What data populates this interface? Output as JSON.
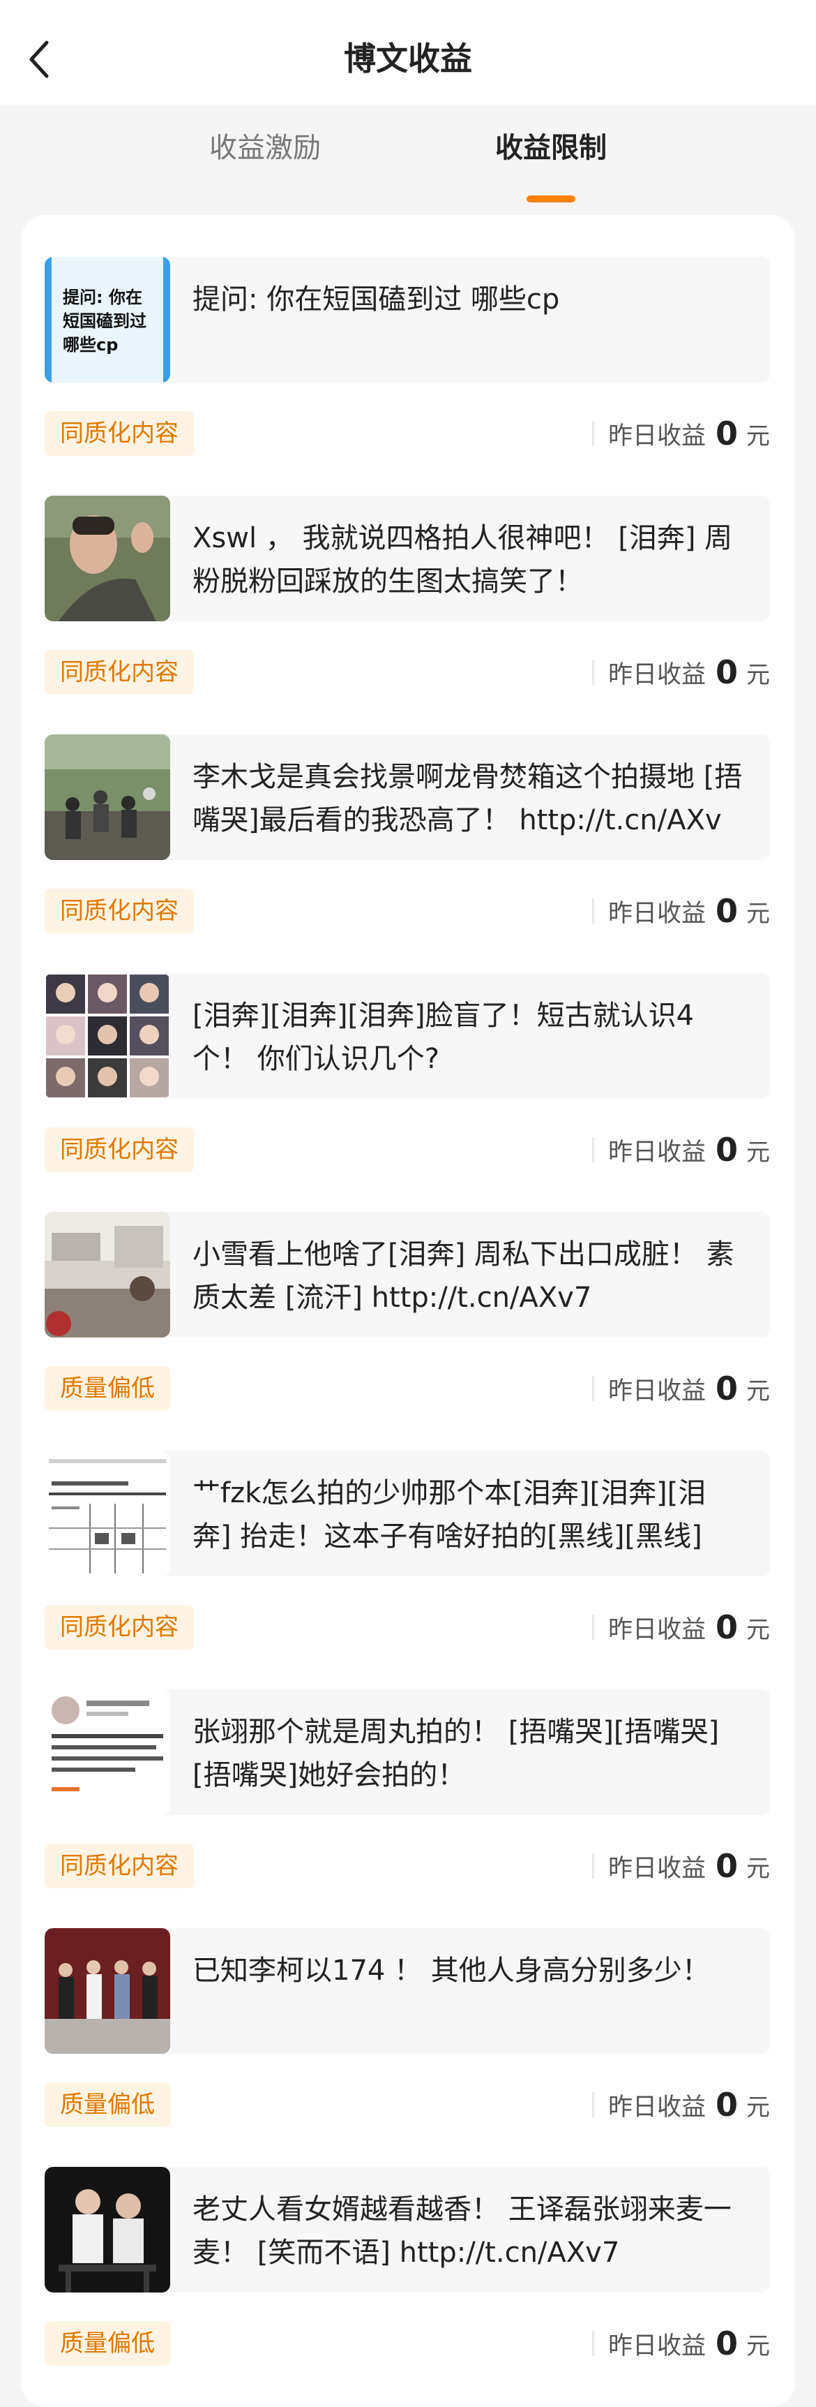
{
  "header": {
    "title": "博文收益"
  },
  "tabs": [
    {
      "label": "收益激励",
      "active": false
    },
    {
      "label": "收益限制",
      "active": true
    }
  ],
  "colors": {
    "accent": "#ff8200",
    "tag_bg": "#fff4e3",
    "tag_text": "#e07800"
  },
  "earnings_label": "昨日收益",
  "currency_unit": "元",
  "posts": [
    {
      "thumb": "thumb-text-card",
      "thumb_text": "提问: 你在短国磕到过哪些cp",
      "text": "提问: 你在短国磕到过 哪些cp",
      "tag": "同质化内容",
      "earnings": "0"
    },
    {
      "thumb": "thumb-man-photo",
      "text": "Xswl ， 我就说四格拍人很神吧！ [泪奔] 周粉脱粉回踩放的生图太搞笑了！",
      "tag": "同质化内容",
      "earnings": "0"
    },
    {
      "thumb": "thumb-crowd-photo",
      "text": "李木戈是真会找景啊龙骨焚箱这个拍摄地 [捂嘴哭]最后看的我恐高了！ http://t.cn/AXv",
      "tag": "同质化内容",
      "earnings": "0"
    },
    {
      "thumb": "thumb-portrait-grid",
      "text": "[泪奔][泪奔][泪奔]脸盲了！短古就认识4个！ 你们认识几个?",
      "tag": "同质化内容",
      "earnings": "0"
    },
    {
      "thumb": "thumb-train-photo",
      "text": "小雪看上他啥了[泪奔] 周私下出口成脏！ 素质太差 [流汗] http://t.cn/AXv7",
      "tag": "质量偏低",
      "earnings": "0"
    },
    {
      "thumb": "thumb-document",
      "text": "艹fzk怎么拍的少帅那个本[泪奔][泪奔][泪奔] 抬走！这本子有啥好拍的[黑线][黑线]",
      "tag": "同质化内容",
      "earnings": "0"
    },
    {
      "thumb": "thumb-screenshot",
      "text": "张翊那个就是周丸拍的！ [捂嘴哭][捂嘴哭][捂嘴哭]她好会拍的！",
      "tag": "同质化内容",
      "earnings": "0"
    },
    {
      "thumb": "thumb-group-photo",
      "text": "已知李柯以174 ！ 其他人身高分别多少！",
      "tag": "质量偏低",
      "earnings": "0"
    },
    {
      "thumb": "thumb-couple-photo",
      "text": "老丈人看女婿越看越香！ 王译磊张翊来麦一麦！ [笑而不语] http://t.cn/AXv7",
      "tag": "质量偏低",
      "earnings": "0"
    }
  ]
}
